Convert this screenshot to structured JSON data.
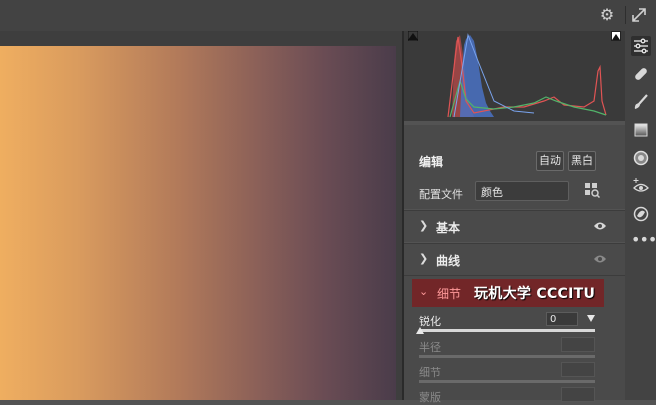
{
  "panel": {
    "edit_title": "编辑",
    "auto_label": "自动",
    "bw_label": "黑白",
    "profile_label": "配置文件",
    "profile_value": "颜色",
    "sections": [
      {
        "label": "基本"
      },
      {
        "label": "曲线"
      }
    ],
    "detail": {
      "label": "细节",
      "watermark": "玩机大学 CCCITU",
      "sharpen_label": "锐化",
      "sharpen_value": "0",
      "radius_label": "半径",
      "detail_label": "细节",
      "masking_label": "蒙版"
    }
  },
  "icons": {
    "settings": "gear-icon",
    "fullscreen": "expand-icon",
    "edit": "sliders-icon",
    "heal": "bandage-icon",
    "brush": "brush-icon",
    "gradient": "linear-gradient-icon",
    "radial": "radial-filter-icon",
    "redeye": "red-eye-icon",
    "presets": "presets-icon",
    "more": "more-icon"
  },
  "colors": {
    "panel_bg": "#535353",
    "section_bg": "#4a4a4a",
    "detail_highlight": "#722628",
    "histogram_blue": "#5b8ee0",
    "histogram_red": "#e05454",
    "histogram_green": "#52b36a"
  }
}
